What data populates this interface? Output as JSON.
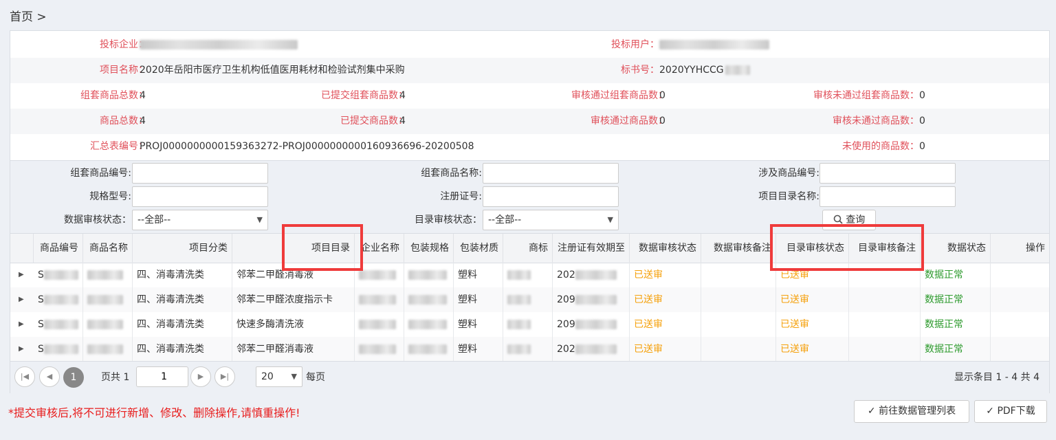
{
  "breadcrumb": "首页 >",
  "info": {
    "bid_company_label": "投标企业：",
    "bid_user_label": "投标用户：",
    "project_name_label": "项目名称：",
    "project_name_value": "2020年岳阳市医疗卫生机构低值医用耗材和检验试剂集中采购",
    "tender_no_label": "标书号：",
    "tender_no_value": "2020YYHCCG",
    "bundle_total_label": "组套商品总数：",
    "bundle_total_value": "4",
    "bundle_submitted_label": "已提交组套商品数：",
    "bundle_submitted_value": "4",
    "bundle_passed_label": "审核通过组套商品数：",
    "bundle_passed_value": "0",
    "bundle_failed_label": "审核未通过组套商品数：",
    "bundle_failed_value": "0",
    "goods_total_label": "商品总数：",
    "goods_total_value": "4",
    "goods_submitted_label": "已提交商品数：",
    "goods_submitted_value": "4",
    "goods_passed_label": "审核通过商品数：",
    "goods_passed_value": "0",
    "goods_failed_label": "审核未通过商品数：",
    "goods_failed_value": "0",
    "summary_no_label": "汇总表编号：",
    "summary_no_value": "PROJ0000000000159363272-PROJ0000000000160936696-20200508",
    "unused_label": "未使用的商品数：",
    "unused_value": "0"
  },
  "filters": {
    "bundle_code_label": "组套商品编号:",
    "bundle_name_label": "组套商品名称:",
    "related_goods_label": "涉及商品编号:",
    "spec_label": "规格型号:",
    "reg_cert_label": "注册证号:",
    "catalog_name_label": "项目目录名称:",
    "data_audit_label": "数据审核状态：",
    "data_audit_value": "--全部--",
    "catalog_audit_label": "目录审核状态：",
    "catalog_audit_value": "--全部--",
    "query_label": "查询"
  },
  "table": {
    "headers": [
      "商品编号",
      "商品名称",
      "项目分类",
      "项目目录",
      "企业名称",
      "包装规格",
      "包装材质",
      "商标",
      "注册证有效期至",
      "数据审核状态",
      "数据审核备注",
      "目录审核状态",
      "目录审核备注",
      "数据状态",
      "操作"
    ],
    "rows": [
      {
        "code": "S",
        "category": "四、消毒清洗类",
        "catalog": "邻苯二甲醛消毒液",
        "material": "塑料",
        "expiry": "202",
        "data_audit": "已送审",
        "catalog_audit": "已送审",
        "status": "数据正常"
      },
      {
        "code": "S",
        "category": "四、消毒清洗类",
        "catalog": "邻苯二甲醛浓度指示卡",
        "material": "塑料",
        "expiry": "209",
        "data_audit": "已送审",
        "catalog_audit": "已送审",
        "status": "数据正常"
      },
      {
        "code": "S",
        "category": "四、消毒清洗类",
        "catalog": "快速多酶清洗液",
        "material": "塑料",
        "expiry": "209",
        "data_audit": "已送审",
        "catalog_audit": "已送审",
        "status": "数据正常"
      },
      {
        "code": "S",
        "category": "四、消毒清洗类",
        "catalog": "邻苯二甲醛消毒液",
        "material": "塑料",
        "expiry": "202",
        "data_audit": "已送审",
        "catalog_audit": "已送审",
        "status": "数据正常"
      }
    ]
  },
  "pager": {
    "current_page": "1",
    "page_of_label": "页共 1",
    "page_input": "1",
    "page_size": "20",
    "per_page_label": "每页",
    "summary": "显示条目 1 - 4 共 4"
  },
  "footer": {
    "warning": "*提交审核后,将不可进行新增、修改、删除操作,请慎重操作!",
    "goto_list_label": "前往数据管理列表",
    "pdf_label": "PDF下载"
  },
  "colors": {
    "label_red": "#e0505a",
    "status_orange": "#f5a00a",
    "status_green": "#2e9b2e",
    "highlight_red": "#ef3b3b"
  }
}
